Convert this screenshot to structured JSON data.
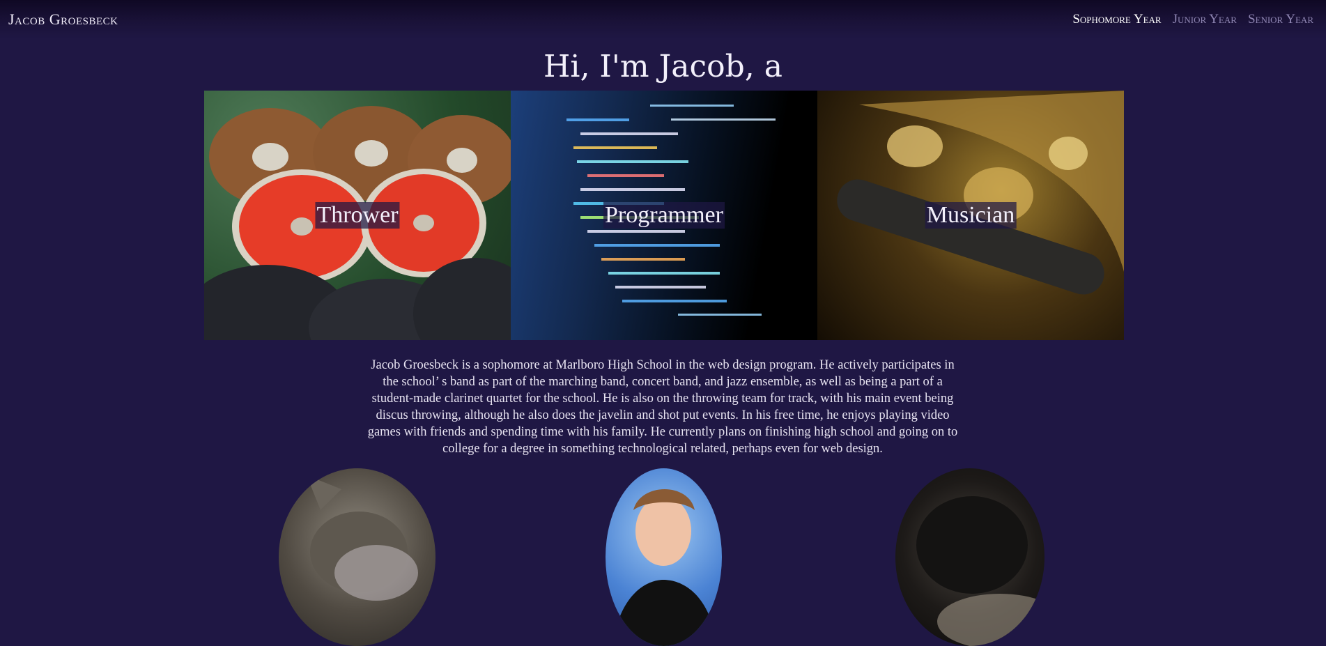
{
  "header": {
    "brand": "Jacob Groesbeck",
    "nav": [
      {
        "label": "Sophomore Year",
        "active": true
      },
      {
        "label": "Junior Year",
        "active": false
      },
      {
        "label": "Senior Year",
        "active": false
      }
    ]
  },
  "hero": {
    "title": "Hi, I'm Jacob, a",
    "panels": [
      {
        "caption": "Thrower",
        "image": "discus-image"
      },
      {
        "caption": "Programmer",
        "image": "code-image"
      },
      {
        "caption": "Musician",
        "image": "saxophone-image"
      }
    ]
  },
  "bio": {
    "text": "Jacob Groesbeck is a sophomore at Marlboro High School in the web design program. He actively participates in the school’ s band as part of the marching band, concert band, and jazz ensemble, as well as being a part of a student-made clarinet quartet for the school. He is also on the throwing team for track, with his main event being discus throwing, although he also does the javelin and shot put events. In his free time, he enjoys playing video games with friends and spending time with his family. He currently plans on finishing high school and going on to college for a degree in something technological related, perhaps even for web design."
  },
  "photos": [
    {
      "name": "cat-photo"
    },
    {
      "name": "portrait-photo"
    },
    {
      "name": "dog-photo"
    }
  ]
}
